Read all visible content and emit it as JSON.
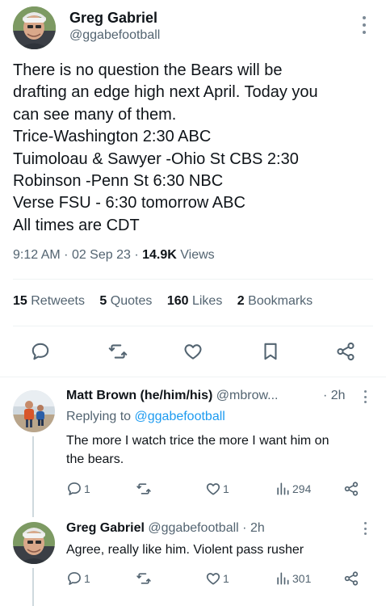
{
  "main_tweet": {
    "author_name": "Greg Gabriel",
    "author_handle": "@ggabefootball",
    "text_lines": [
      "There is no question the Bears will be",
      "drafting an edge high next April. Today you",
      "can see many of them.",
      "Trice-Washington 2:30 ABC",
      "Tuimoloau & Sawyer -Ohio St CBS 2:30",
      "Robinson -Penn St 6:30 NBC",
      "Verse FSU - 6:30 tomorrow ABC",
      "All times are CDT"
    ],
    "time": "9:12 AM",
    "date": "02 Sep 23",
    "views_count": "14.9K",
    "views_label": "Views",
    "stats": {
      "retweets": {
        "count": "15",
        "label": "Retweets"
      },
      "quotes": {
        "count": "5",
        "label": "Quotes"
      },
      "likes": {
        "count": "160",
        "label": "Likes"
      },
      "bookmarks": {
        "count": "2",
        "label": "Bookmarks"
      }
    },
    "icons": [
      "reply-icon",
      "retweet-icon",
      "like-icon",
      "bookmark-icon",
      "share-icon"
    ]
  },
  "replies": [
    {
      "author_name": "Matt Brown (he/him/his)",
      "author_handle": "@mbrow...",
      "time": "2h",
      "replying_to_prefix": "Replying to",
      "replying_to_handle": "@ggabefootball",
      "text_lines": [
        "The more I watch trice the more I want him on",
        "the bears."
      ],
      "reply_count": "1",
      "retweet_count": "",
      "like_count": "1",
      "view_count": "294"
    },
    {
      "author_name": "Greg Gabriel",
      "author_handle": "@ggabefootball",
      "time": "2h",
      "text_lines": [
        "Agree, really like him. Violent pass rusher"
      ],
      "reply_count": "1",
      "retweet_count": "",
      "like_count": "1",
      "view_count": "301"
    }
  ],
  "colors": {
    "text_primary": "#0f1419",
    "text_secondary": "#536471",
    "link": "#1d9bf0",
    "divider": "#eff3f4",
    "thread_line": "#cfd9de"
  }
}
